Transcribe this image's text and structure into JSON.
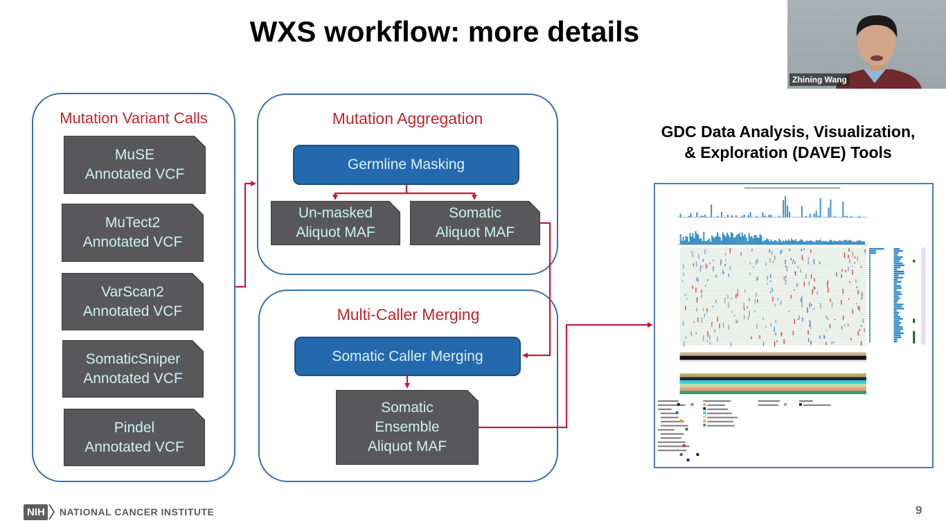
{
  "slide": {
    "title": "WXS workflow: more details",
    "page_number": "9"
  },
  "groups": {
    "variant_calls": {
      "title": "Mutation Variant Calls",
      "docs": [
        {
          "line1": "MuSE",
          "line2": "Annotated VCF"
        },
        {
          "line1": "MuTect2",
          "line2": "Annotated VCF"
        },
        {
          "line1": "VarScan2",
          "line2": "Annotated VCF"
        },
        {
          "line1": "SomaticSniper",
          "line2": "Annotated VCF"
        },
        {
          "line1": "Pindel",
          "line2": "Annotated VCF"
        }
      ]
    },
    "aggregation": {
      "title": "Mutation Aggregation",
      "process": "Germline Masking",
      "outputs": [
        {
          "line1": "Un-masked",
          "line2": "Aliquot MAF"
        },
        {
          "line1": "Somatic",
          "line2": "Aliquot MAF"
        }
      ]
    },
    "merging": {
      "title": "Multi-Caller Merging",
      "process": "Somatic Caller Merging",
      "output": {
        "line1": "Somatic",
        "line2": "Ensemble",
        "line3": "Aliquot MAF"
      }
    }
  },
  "dave": {
    "title_line1": "GDC Data Analysis, Visualization,",
    "title_line2": "& Exploration (DAVE) Tools"
  },
  "webcam": {
    "participant_name": "Zhining Wang"
  },
  "footer": {
    "nih_badge": "NIH",
    "institute": "NATIONAL CANCER INSTITUTE"
  },
  "colors": {
    "group_border": "#3a6fa6",
    "group_title": "#c0262d",
    "doc_fill": "#58585a",
    "doc_text": "#cdf1f3",
    "process_fill": "#2469ad",
    "arrow": "#c8193c"
  }
}
